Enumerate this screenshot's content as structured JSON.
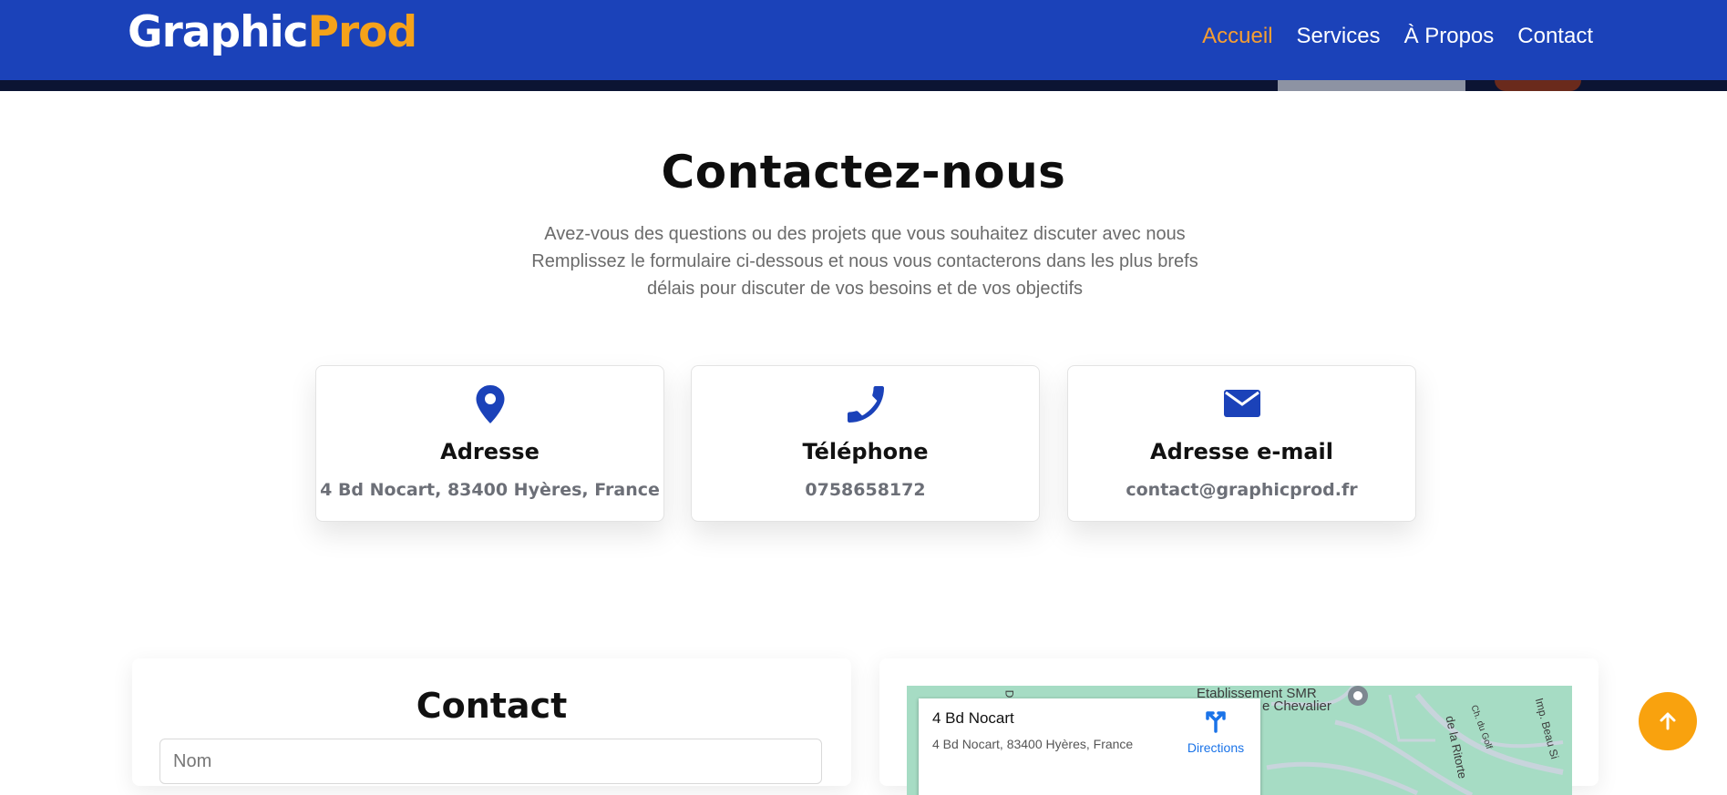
{
  "header": {
    "logo_part1": "Graphic",
    "logo_part2": "Prod",
    "nav": [
      "Accueil",
      "Services",
      "À Propos",
      "Contact"
    ],
    "active_nav": "Accueil"
  },
  "hero": {
    "title": "Contactez-nous",
    "subtitle": "Avez-vous des questions ou des projets que vous souhaitez discuter avec nous Remplissez le formulaire ci-dessous et nous vous contacterons dans les plus brefs délais pour discuter de vos besoins et de vos objectifs"
  },
  "cards": [
    {
      "icon": "map-marker-icon",
      "title": "Adresse",
      "value": "4 Bd Nocart, 83400 Hyères, France"
    },
    {
      "icon": "phone-icon",
      "title": "Téléphone",
      "value": "0758658172"
    },
    {
      "icon": "envelope-icon",
      "title": "Adresse e-mail",
      "value": "contact@graphicprod.fr"
    }
  ],
  "form": {
    "title": "Contact",
    "name_placeholder": "Nom"
  },
  "map": {
    "place_title": "4 Bd Nocart",
    "place_address": "4 Bd Nocart, 83400 Hyères, France",
    "directions_label": "Directions",
    "labels": [
      "Etablissement SMR",
      "e Chevalier",
      "de la Ritorte",
      "Imp. Beau Si",
      "Ch. du Golf",
      "D"
    ]
  },
  "colors": {
    "navbar": "#1b42b9",
    "accent": "#f5a21a",
    "icon_blue": "#1b42b9",
    "scroll_button": "#f9a20e"
  }
}
